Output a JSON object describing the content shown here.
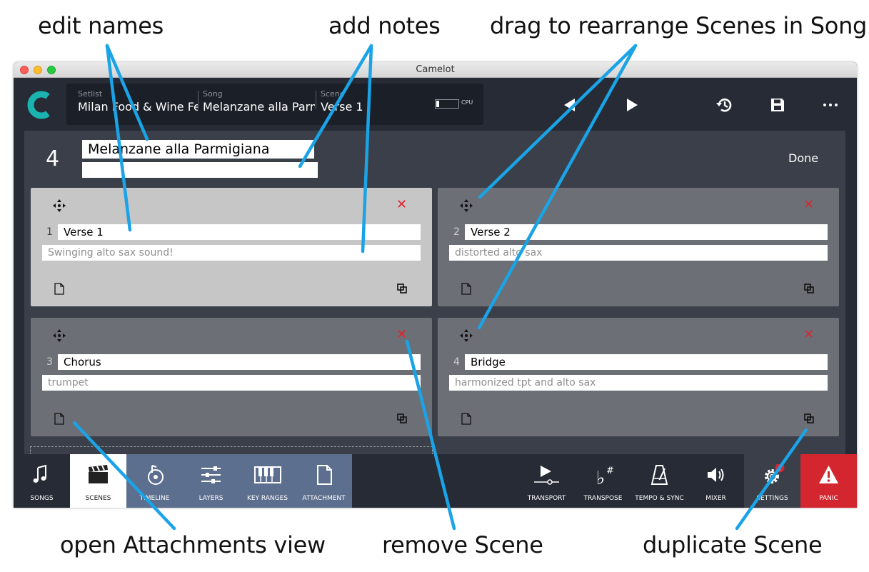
{
  "annotations": {
    "edit_names": "edit names",
    "add_notes": "add notes",
    "drag_rearrange": "drag to rearrange Scenes in Song",
    "open_attachments": "open Attachments view",
    "remove_scene": "remove Scene",
    "duplicate_scene": "duplicate Scene"
  },
  "window": {
    "title": "Camelot"
  },
  "topbar": {
    "setlist_label": "Setlist",
    "setlist_value": "Milan Food & Wine Festival",
    "song_label": "Song",
    "song_value": "Melanzane alla Parmigiana",
    "scene_label": "Scene",
    "scene_value": "Verse 1",
    "cpu_label": "CPU",
    "cpu_level": 0.12
  },
  "song": {
    "number": "4",
    "name": "Melanzane alla Parmigiana",
    "notes": "",
    "done_label": "Done"
  },
  "scenes": [
    {
      "number": "1",
      "name": "Verse 1",
      "notes": "Swinging alto sax sound!",
      "selected": true
    },
    {
      "number": "2",
      "name": "Verse 2",
      "notes": "distorted alto sax",
      "selected": false
    },
    {
      "number": "3",
      "name": "Chorus",
      "notes": "trumpet",
      "selected": false
    },
    {
      "number": "4",
      "name": "Bridge",
      "notes": "harmonized tpt and alto sax",
      "selected": false
    }
  ],
  "bottom_tabs": {
    "left": [
      {
        "label": "SONGS",
        "icon": "music-note-icon"
      },
      {
        "label": "SCENES",
        "icon": "clapperboard-icon"
      },
      {
        "label": "TIMELINE",
        "icon": "timeline-icon"
      },
      {
        "label": "LAYERS",
        "icon": "sliders-icon"
      },
      {
        "label": "KEY RANGES",
        "icon": "piano-keys-icon"
      },
      {
        "label": "ATTACHMENT",
        "icon": "document-icon"
      }
    ],
    "right": [
      {
        "label": "TRANSPORT",
        "icon": "transport-icon"
      },
      {
        "label": "TRANSPOSE",
        "icon": "flat-sharp-icon"
      },
      {
        "label": "TEMPO & SYNC",
        "icon": "metronome-icon"
      },
      {
        "label": "MIXER",
        "icon": "speaker-icon"
      },
      {
        "label": "SETTINGS",
        "icon": "gear-icon",
        "badge": "!"
      },
      {
        "label": "PANIC",
        "icon": "warning-icon"
      }
    ]
  },
  "colors": {
    "accent_callout": "#1aa3e6",
    "app_bg": "#262b35",
    "content_bg": "#3a3f49",
    "selected_card": "#c6c6c6",
    "card": "#6c6f75",
    "blue_tab": "#5d6f8e",
    "panic": "#d3262f",
    "delete_x": "#e3232e",
    "logo_teal": "#1ab3b0"
  }
}
